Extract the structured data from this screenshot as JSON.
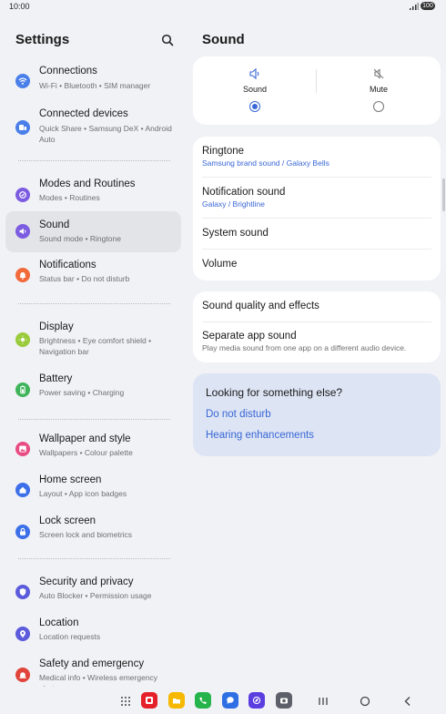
{
  "status_bar": {
    "time": "10:00",
    "battery": "100"
  },
  "left": {
    "title": "Settings",
    "items": [
      {
        "title": "Connections",
        "subtitle": "Wi-Fi  •  Bluetooth  •  SIM manager",
        "icon": "wifi-icon",
        "color": "#4a7fea"
      },
      {
        "title": "Connected devices",
        "subtitle": "Quick Share  •  Samsung DeX  •  Android Auto",
        "icon": "devices-icon",
        "color": "#4a7fea"
      },
      {
        "title": "Modes and Routines",
        "subtitle": "Modes  •  Routines",
        "icon": "routines-icon",
        "color": "#7c5ce0"
      },
      {
        "title": "Sound",
        "subtitle": "Sound mode  •  Ringtone",
        "icon": "volume-icon",
        "color": "#7c5ce0"
      },
      {
        "title": "Notifications",
        "subtitle": "Status bar  •  Do not disturb",
        "icon": "bell-icon",
        "color": "#f26a3a"
      },
      {
        "title": "Display",
        "subtitle": "Brightness  •  Eye comfort shield  •  Navigation bar",
        "icon": "sun-icon",
        "color": "#9acb3b"
      },
      {
        "title": "Battery",
        "subtitle": "Power saving  •  Charging",
        "icon": "battery-icon",
        "color": "#3fb45a"
      },
      {
        "title": "Wallpaper and style",
        "subtitle": "Wallpapers  •  Colour palette",
        "icon": "wallpaper-icon",
        "color": "#e84c83"
      },
      {
        "title": "Home screen",
        "subtitle": "Layout  •  App icon badges",
        "icon": "home-icon",
        "color": "#3d70e8"
      },
      {
        "title": "Lock screen",
        "subtitle": "Screen lock and biometrics",
        "icon": "lock-icon",
        "color": "#3d70e8"
      },
      {
        "title": "Security and privacy",
        "subtitle": "Auto Blocker  •  Permission usage",
        "icon": "shield-icon",
        "color": "#5b5bdc"
      },
      {
        "title": "Location",
        "subtitle": "Location requests",
        "icon": "location-pin-icon",
        "color": "#5b5bdc"
      },
      {
        "title": "Safety and emergency",
        "subtitle": "Medical info  •  Wireless emergency alerts",
        "icon": "emergency-icon",
        "color": "#e0443b"
      }
    ]
  },
  "right": {
    "title": "Sound",
    "modes": [
      {
        "label": "Sound",
        "selected": true
      },
      {
        "label": "Mute",
        "selected": false
      }
    ],
    "ringtone": {
      "title": "Ringtone",
      "value": "Samsung brand sound / Galaxy Bells"
    },
    "notification_sound": {
      "title": "Notification sound",
      "value": "Galaxy / Brightline"
    },
    "system_sound": {
      "title": "System sound"
    },
    "volume": {
      "title": "Volume"
    },
    "sound_quality": {
      "title": "Sound quality and effects"
    },
    "separate_app_sound": {
      "title": "Separate app sound",
      "desc": "Play media sound from one app on a different audio device."
    },
    "suggest": {
      "question": "Looking for something else?",
      "links": [
        "Do not disturb",
        "Hearing enhancements"
      ]
    }
  },
  "colors": {
    "accent": "#3967d6",
    "selected_bg": "#e3e4e8",
    "suggest_bg": "#dde4f4"
  },
  "navbar": {
    "dock_apps": [
      {
        "icon": "flipboard-icon",
        "color": "#e5202a"
      },
      {
        "icon": "folder-icon",
        "color": "#f6b800"
      },
      {
        "icon": "phone-icon",
        "color": "#25b34b"
      },
      {
        "icon": "messages-icon",
        "color": "#2f6fe4"
      },
      {
        "icon": "internet-icon",
        "color": "#5a3ee0"
      },
      {
        "icon": "camera-icon",
        "color": "#5d6068"
      }
    ]
  }
}
